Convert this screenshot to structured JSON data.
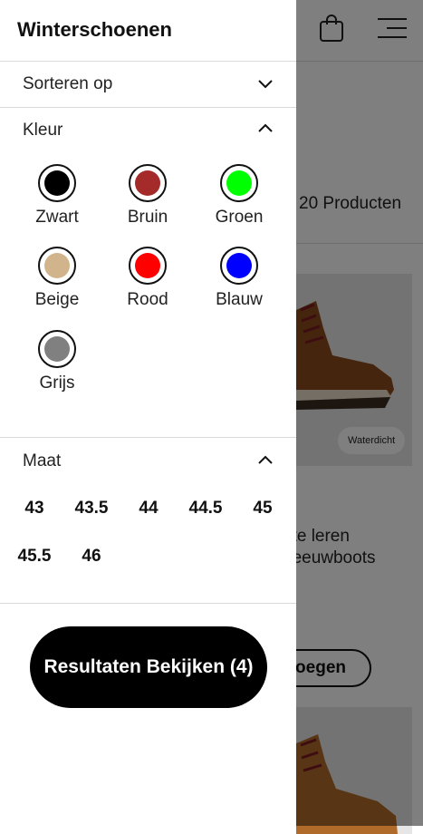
{
  "background": {
    "product_count": "20 Producten",
    "badge": "Waterdicht",
    "description": "nte leren\nneeuwboots\nn",
    "add_button": "roegen"
  },
  "panel": {
    "title": "Winterschoenen",
    "sort": {
      "label": "Sorteren op"
    },
    "color": {
      "label": "Kleur",
      "options": [
        {
          "label": "Zwart",
          "hex": "#000000"
        },
        {
          "label": "Bruin",
          "hex": "#a52a2a"
        },
        {
          "label": "Groen",
          "hex": "#00ff00"
        },
        {
          "label": "Beige",
          "hex": "#d2b48c"
        },
        {
          "label": "Rood",
          "hex": "#ff0000"
        },
        {
          "label": "Blauw",
          "hex": "#0000ff"
        },
        {
          "label": "Grijs",
          "hex": "#808080"
        }
      ]
    },
    "size": {
      "label": "Maat",
      "options": [
        "43",
        "43.5",
        "44",
        "44.5",
        "45",
        "45.5",
        "46"
      ]
    },
    "results_button": "Resultaten Bekijken (4)"
  },
  "icons": [
    "shopping-bag-icon",
    "menu-icon",
    "chevron-down-icon",
    "chevron-up-icon"
  ]
}
